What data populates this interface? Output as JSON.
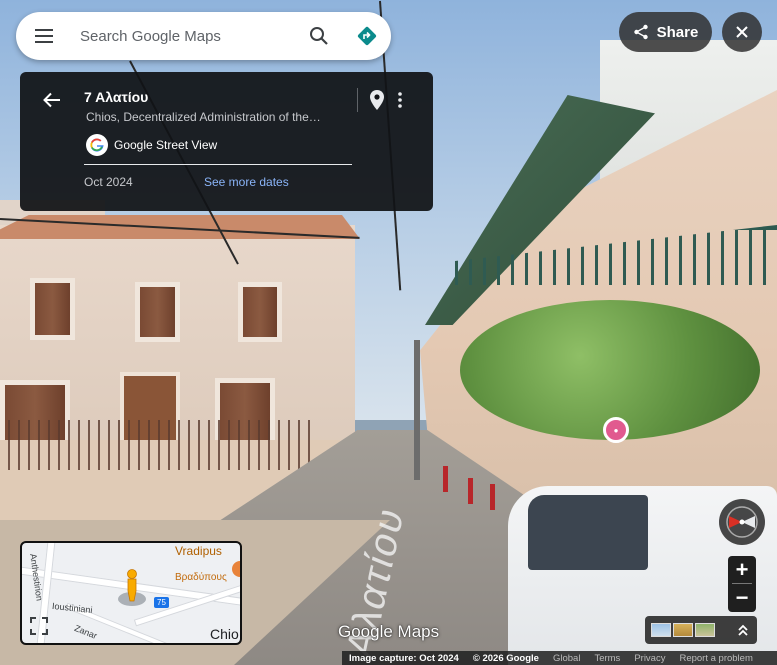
{
  "search": {
    "placeholder": "Search Google Maps"
  },
  "top_right": {
    "share_label": "Share"
  },
  "place_card": {
    "title": "7 Αλατίου",
    "subtitle": "Chios, Decentralized Administration of the…",
    "source_label": "Google Street View",
    "capture_date": "Oct 2024",
    "see_more_label": "See more dates"
  },
  "street_label": "Αλατίου",
  "minimap": {
    "place_name": "Vradipus",
    "place_name_local": "Βραδύπους",
    "street_1": "Anthestirion",
    "street_2": "Ioustiniani",
    "street_3": "Zanar",
    "road_shield": "75",
    "city": "Chio"
  },
  "controls": {
    "zoom_in": "+",
    "zoom_out": "−"
  },
  "branding": {
    "wordmark": "Google Maps"
  },
  "footer": {
    "capture": "Image capture: Oct 2024",
    "copyright": "© 2026 Google",
    "global": "Global",
    "terms": "Terms",
    "privacy": "Privacy",
    "report": "Report a problem"
  },
  "icons": {
    "menu": "menu-icon",
    "search": "search-icon",
    "directions": "directions-icon",
    "share": "share-icon",
    "close": "close-icon",
    "back": "arrow-back-icon",
    "pin": "pin-icon",
    "more": "more-vert-icon",
    "expand": "expand-icon",
    "compass": "compass-icon",
    "chevron": "chevron-up-icon"
  },
  "colors": {
    "card_bg": "#101216",
    "link": "#8ab4f8",
    "directions": "#0b8b8c",
    "minimap_place": "#b06000"
  }
}
